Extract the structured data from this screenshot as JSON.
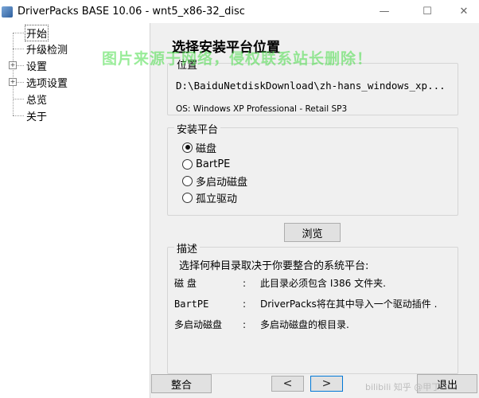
{
  "window": {
    "title": "DriverPacks BASE 10.06 -  wnt5_x86-32_disc",
    "min_glyph": "—",
    "max_glyph": "☐",
    "close_glyph": "✕"
  },
  "tree": {
    "items": [
      {
        "label": "开始",
        "selected": true,
        "expandable": false
      },
      {
        "label": "升级检测",
        "selected": false,
        "expandable": false
      },
      {
        "label": "设置",
        "selected": false,
        "expandable": true
      },
      {
        "label": "选项设置",
        "selected": false,
        "expandable": true
      },
      {
        "label": "总览",
        "selected": false,
        "expandable": false
      },
      {
        "label": "关于",
        "selected": false,
        "expandable": false
      }
    ],
    "expander_glyph": "+"
  },
  "page": {
    "title": "选择安装平台位置",
    "watermark": "图片来源于网络，侵权联系站长删除！"
  },
  "location": {
    "legend": "位置",
    "path": "D:\\BaiduNetdiskDownload\\zh-hans_windows_xp...",
    "os": "OS: Windows XP Professional -  Retail SP3"
  },
  "platform": {
    "legend": "安装平台",
    "options": [
      {
        "label": "磁盘",
        "checked": true
      },
      {
        "label": "BartPE",
        "checked": false
      },
      {
        "label": "多启动磁盘",
        "checked": false
      },
      {
        "label": "孤立驱动",
        "checked": false
      }
    ]
  },
  "browse": {
    "label": "浏览"
  },
  "description": {
    "legend": "描述",
    "intro": "选择何种目录取决于你要整合的系统平台:",
    "rows": [
      {
        "term": "磁      盘",
        "colon": ":",
        "text": "此目录必须包含 I386 文件夹."
      },
      {
        "term": "BartPE",
        "colon": ":",
        "text": "DriverPacks将在其中导入一个驱动插件 ."
      },
      {
        "term": "多启动磁盘",
        "colon": ":",
        "text": "多启动磁盘的根目录."
      }
    ]
  },
  "footer": {
    "integrate_label": "整合",
    "back_glyph": "<",
    "next_glyph": ">",
    "exit_label": "退出",
    "watermark": "bilibili 知乎 @甲丁"
  }
}
